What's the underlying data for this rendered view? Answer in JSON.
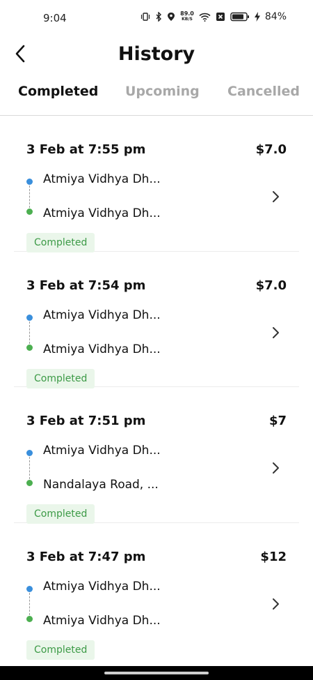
{
  "status_bar": {
    "time": "9:04",
    "net_speed_value": "89.0",
    "net_speed_unit": "KB/S",
    "battery": "84%"
  },
  "header": {
    "title": "History",
    "back_icon": "chevron-left-icon"
  },
  "tabs": [
    {
      "label": "Completed",
      "active": true
    },
    {
      "label": "Upcoming",
      "active": false
    },
    {
      "label": "Cancelled",
      "active": false
    }
  ],
  "trips": [
    {
      "datetime": "3 Feb at 7:55 pm",
      "fare": "$7.0",
      "pickup": "Atmiya Vidhya Dh...",
      "drop": "Atmiya Vidhya Dh...",
      "status": "Completed"
    },
    {
      "datetime": "3 Feb at 7:54 pm",
      "fare": "$7.0",
      "pickup": "Atmiya Vidhya Dh...",
      "drop": "Atmiya Vidhya Dh...",
      "status": "Completed"
    },
    {
      "datetime": "3 Feb at 7:51 pm",
      "fare": "$7",
      "pickup": "Atmiya Vidhya Dh...",
      "drop": "Nandalaya Road, ...",
      "status": "Completed"
    },
    {
      "datetime": "3 Feb at 7:47 pm",
      "fare": "$12",
      "pickup": "Atmiya Vidhya Dh...",
      "drop": "Atmiya Vidhya Dh...",
      "status": "Completed"
    }
  ],
  "colors": {
    "pickup_dot": "#3a8fdc",
    "drop_dot": "#4caf50",
    "badge_bg": "#eaf6ea",
    "badge_text": "#3c9a46",
    "inactive_tab": "#a8a8a8"
  }
}
